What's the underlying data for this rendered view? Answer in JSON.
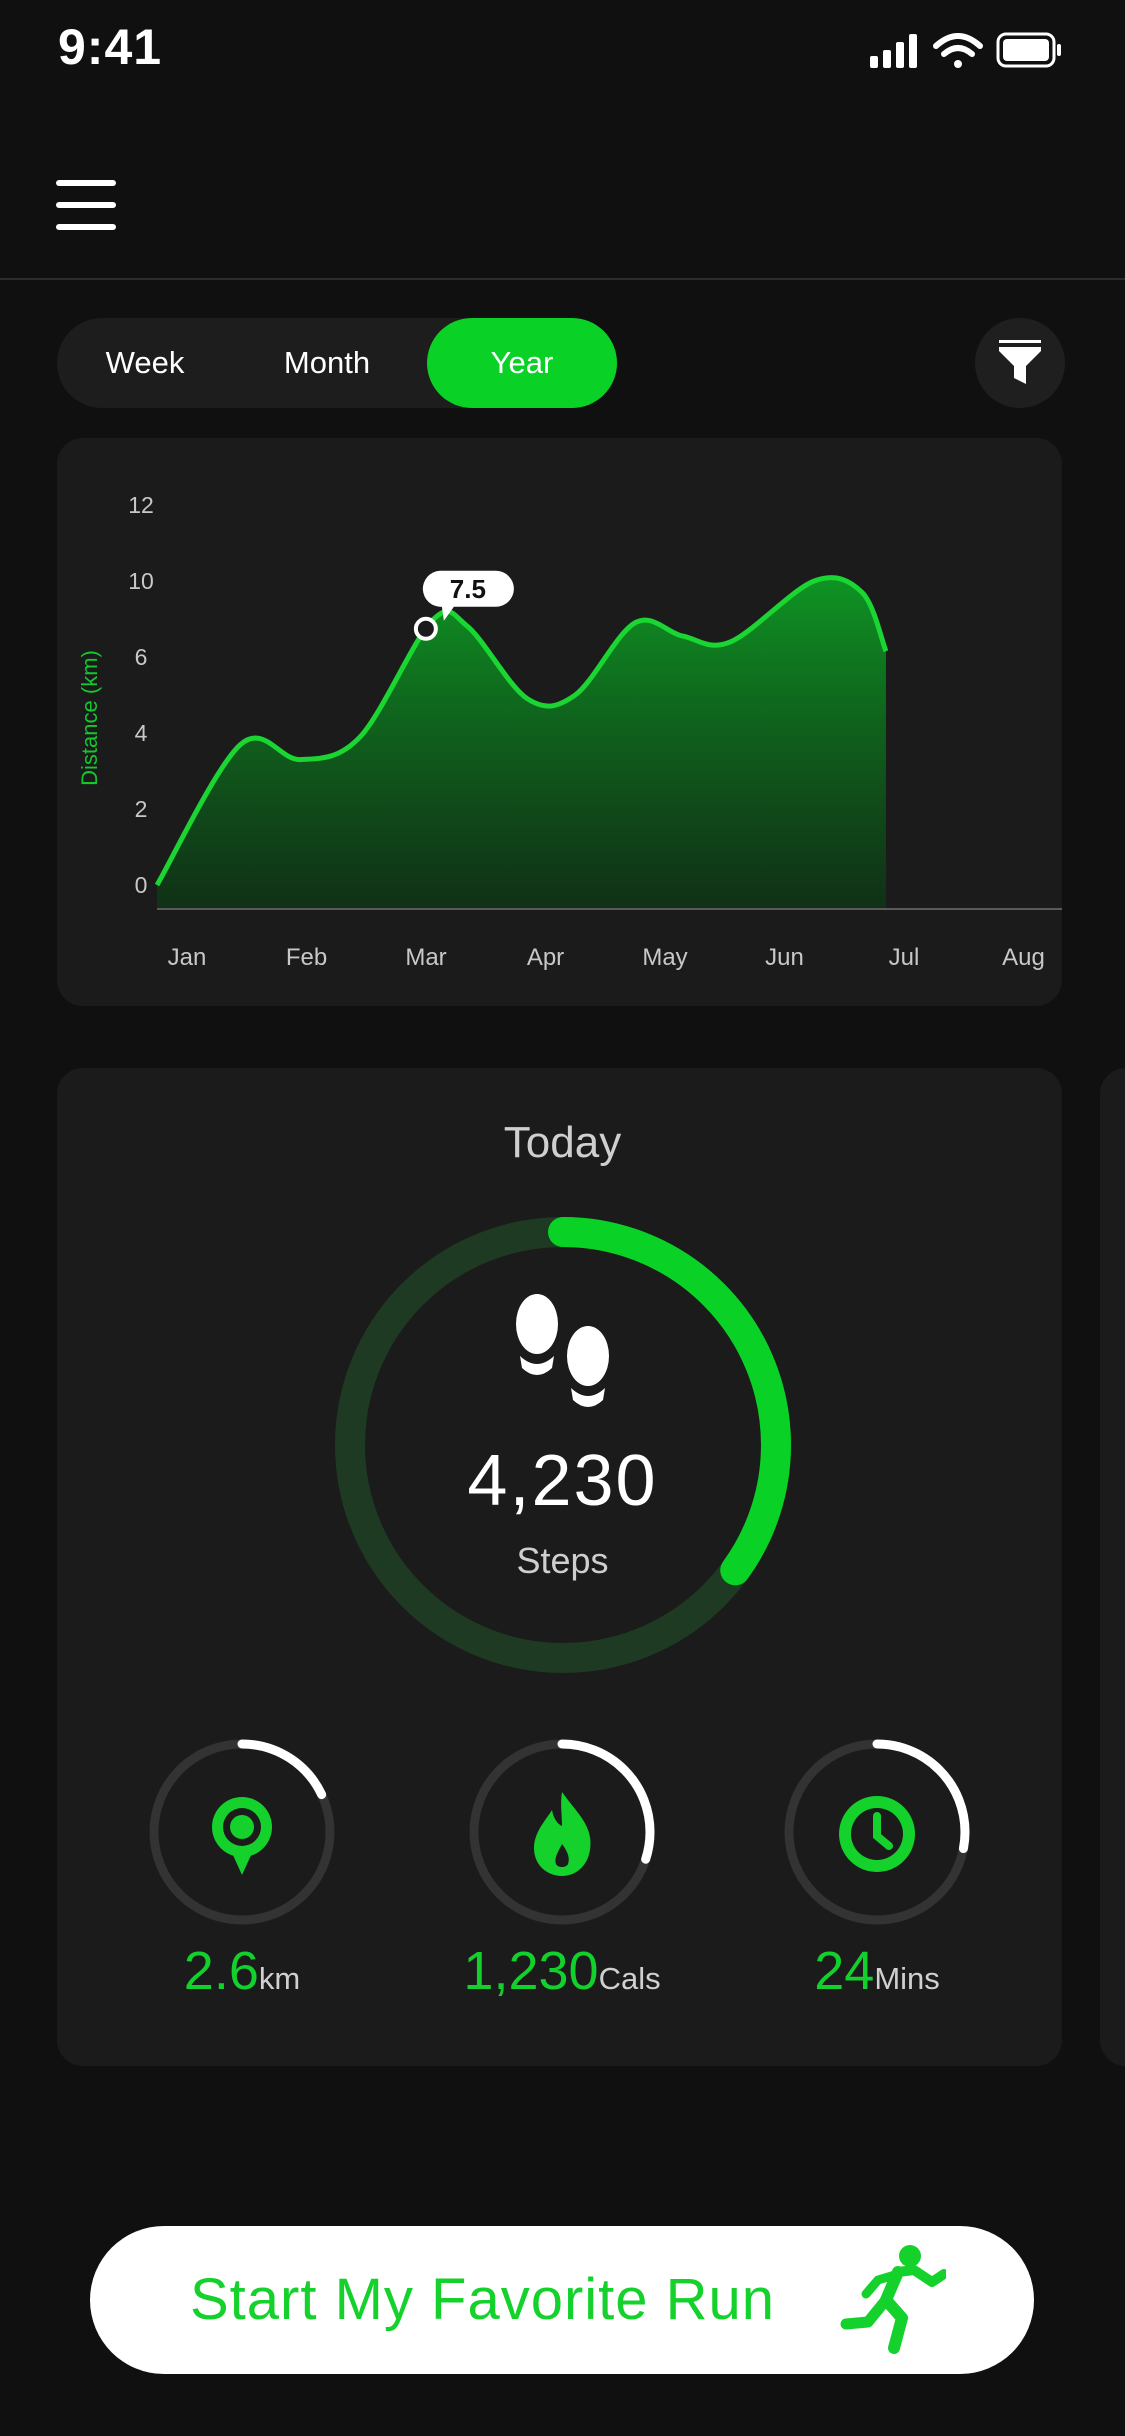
{
  "status_bar": {
    "time": "9:41"
  },
  "segments": {
    "items": [
      {
        "label": "Week"
      },
      {
        "label": "Month"
      },
      {
        "label": "Year"
      }
    ],
    "selected": "Year"
  },
  "colors": {
    "accent": "#0ad126",
    "card": "#1b1b1b",
    "background": "#101010"
  },
  "chart_data": {
    "type": "area",
    "title": "",
    "ylabel": "Distance (km)",
    "xlabel": "",
    "categories": [
      "Jan",
      "Feb",
      "Mar",
      "Apr",
      "May",
      "Jun",
      "Jul",
      "Aug"
    ],
    "y_ticks": [
      "0",
      "2",
      "4",
      "6",
      "10",
      "12"
    ],
    "series": [
      {
        "values": [
          [
            0.0,
            0.0
          ],
          [
            0.7,
            3.7
          ],
          [
            1.2,
            3.3
          ],
          [
            1.7,
            3.9
          ],
          [
            2.3,
            7.9
          ],
          [
            2.6,
            7.6
          ],
          [
            3.1,
            4.9
          ],
          [
            3.5,
            5.0
          ],
          [
            4.0,
            7.8
          ],
          [
            4.4,
            7.1
          ],
          [
            4.8,
            6.8
          ],
          [
            5.5,
            10.0
          ],
          [
            5.9,
            9.4
          ],
          [
            6.1,
            6.3
          ]
        ]
      }
    ],
    "highlight": {
      "x": 2.25,
      "label": "7.5"
    },
    "grid": false,
    "legend": "none"
  },
  "today": {
    "title": "Today",
    "steps_value": "4,230",
    "steps_label": "Steps",
    "steps_progress": 0.35,
    "metrics": [
      {
        "value": "2.6",
        "unit": "km",
        "icon": "location-pin-icon",
        "progress": 0.18
      },
      {
        "value": "1,230",
        "unit": "Cals",
        "icon": "flame-icon",
        "progress": 0.3
      },
      {
        "value": "24",
        "unit": "Mins",
        "icon": "clock-icon",
        "progress": 0.28
      }
    ]
  },
  "cta": {
    "label": "Start My Favorite Run",
    "icon": "runner-icon"
  }
}
